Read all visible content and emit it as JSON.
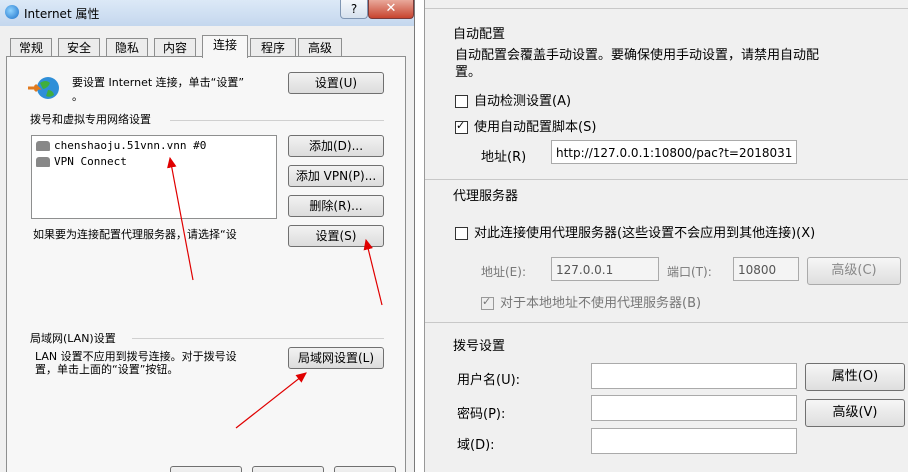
{
  "left_window": {
    "title": "Internet 属性",
    "help_label": "?",
    "close_label": "✕",
    "tabs": [
      "常规",
      "安全",
      "隐私",
      "内容",
      "连接",
      "程序",
      "高级"
    ],
    "setup_text_line1": "要设置 Internet 连接，单击“设置”",
    "setup_text_line2": "。",
    "setup_button": "设置(U)",
    "dialup_section": "拨号和虚拟专用网络设置",
    "connections": [
      "chenshaoju.51vnn.vnn #0",
      "VPN Connect"
    ],
    "add_button": "添加(D)...",
    "add_vpn_button": "添加 VPN(P)...",
    "remove_button": "删除(R)...",
    "proxy_hint": "如果要为连接配置代理服务器，请选择“设",
    "settings_button": "设置(S)",
    "lan_section": "局域网(LAN)设置",
    "lan_text_line1": "LAN 设置不应用到拨号连接。对于拨号设",
    "lan_text_line2": "置，单击上面的“设置”按钮。",
    "lan_button": "局域网设置(L)"
  },
  "right_window": {
    "auto_config": {
      "header": "自动配置",
      "desc_line1": "自动配置会覆盖手动设置。要确保使用手动设置，请禁用自动配",
      "desc_line2": "置。",
      "auto_detect_label": "自动检测设置(A)",
      "auto_detect_checked": false,
      "use_script_label": "使用自动配置脚本(S)",
      "use_script_checked": true,
      "address_label": "地址(R)",
      "address_value": "http://127.0.0.1:10800/pac?t=2018031"
    },
    "proxy": {
      "header": "代理服务器",
      "use_proxy_label": "对此连接使用代理服务器(这些设置不会应用到其他连接)(X)",
      "use_proxy_checked": false,
      "address_label": "地址(E):",
      "address_value": "127.0.0.1",
      "port_label": "端口(T):",
      "port_value": "10800",
      "advanced_button": "高级(C)",
      "bypass_label": "对于本地地址不使用代理服务器(B)",
      "bypass_checked": true
    },
    "dialup": {
      "header": "拨号设置",
      "username_label": "用户名(U):",
      "username_value": "",
      "password_label": "密码(P):",
      "password_value": "",
      "domain_label": "域(D):",
      "domain_value": "",
      "properties_button": "属性(O)",
      "advanced_button": "高级(V)"
    }
  },
  "colors": {
    "annotation_arrow": "#e00000",
    "titlebar": "#c4d7ee",
    "close_button": "#c7442f"
  }
}
